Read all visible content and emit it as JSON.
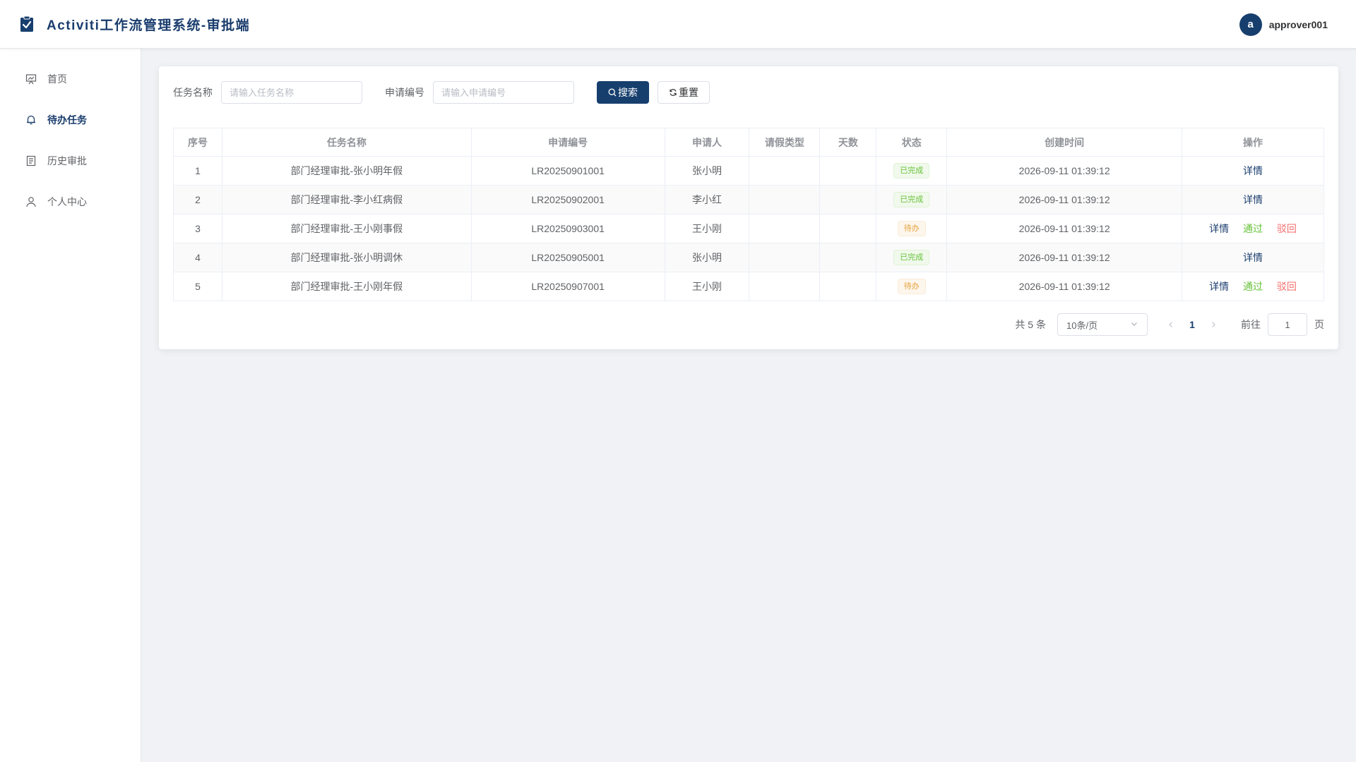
{
  "header": {
    "title": "Activiti工作流管理系统-审批端",
    "logo_icon": "clipboard-check-icon",
    "user": {
      "avatar_letter": "a",
      "name": "approver001"
    }
  },
  "sidebar": {
    "items": [
      {
        "label": "首页",
        "icon": "presentation-icon",
        "active": false
      },
      {
        "label": "待办任务",
        "icon": "bell-icon",
        "active": true
      },
      {
        "label": "历史审批",
        "icon": "document-icon",
        "active": false
      },
      {
        "label": "个人中心",
        "icon": "user-icon",
        "active": false
      }
    ]
  },
  "search": {
    "task_name_label": "任务名称",
    "task_name_placeholder": "请输入任务名称",
    "task_name_value": "",
    "apply_no_label": "申请编号",
    "apply_no_placeholder": "请输入申请编号",
    "apply_no_value": "",
    "search_button": "搜索",
    "reset_button": "重置"
  },
  "table": {
    "columns": [
      "序号",
      "任务名称",
      "申请编号",
      "申请人",
      "请假类型",
      "天数",
      "状态",
      "创建时间",
      "操作"
    ],
    "rows": [
      {
        "index": "1",
        "task_name": "部门经理审批-张小明年假",
        "apply_no": "LR20250901001",
        "applicant": "张小明",
        "leave_type": "",
        "days": "",
        "status": "已完成",
        "status_type": "success",
        "created": "2026-09-11 01:39:12",
        "actions": [
          "详情"
        ]
      },
      {
        "index": "2",
        "task_name": "部门经理审批-李小红病假",
        "apply_no": "LR20250902001",
        "applicant": "李小红",
        "leave_type": "",
        "days": "",
        "status": "已完成",
        "status_type": "success",
        "created": "2026-09-11 01:39:12",
        "actions": [
          "详情"
        ]
      },
      {
        "index": "3",
        "task_name": "部门经理审批-王小刚事假",
        "apply_no": "LR20250903001",
        "applicant": "王小刚",
        "leave_type": "",
        "days": "",
        "status": "待办",
        "status_type": "warning",
        "created": "2026-09-11 01:39:12",
        "actions": [
          "详情",
          "通过",
          "驳回"
        ]
      },
      {
        "index": "4",
        "task_name": "部门经理审批-张小明调休",
        "apply_no": "LR20250905001",
        "applicant": "张小明",
        "leave_type": "",
        "days": "",
        "status": "已完成",
        "status_type": "success",
        "created": "2026-09-11 01:39:12",
        "actions": [
          "详情"
        ]
      },
      {
        "index": "5",
        "task_name": "部门经理审批-王小刚年假",
        "apply_no": "LR20250907001",
        "applicant": "王小刚",
        "leave_type": "",
        "days": "",
        "status": "待办",
        "status_type": "warning",
        "created": "2026-09-11 01:39:12",
        "actions": [
          "详情",
          "通过",
          "驳回"
        ]
      }
    ]
  },
  "pagination": {
    "total_text": "共 5 条",
    "page_size": "10条/页",
    "current_page": "1",
    "goto_label": "前往",
    "goto_value": "1",
    "page_suffix": "页"
  },
  "colors": {
    "primary": "#173f6e",
    "success": "#67c23a",
    "warning": "#e6a23c",
    "danger": "#f56c6c"
  }
}
